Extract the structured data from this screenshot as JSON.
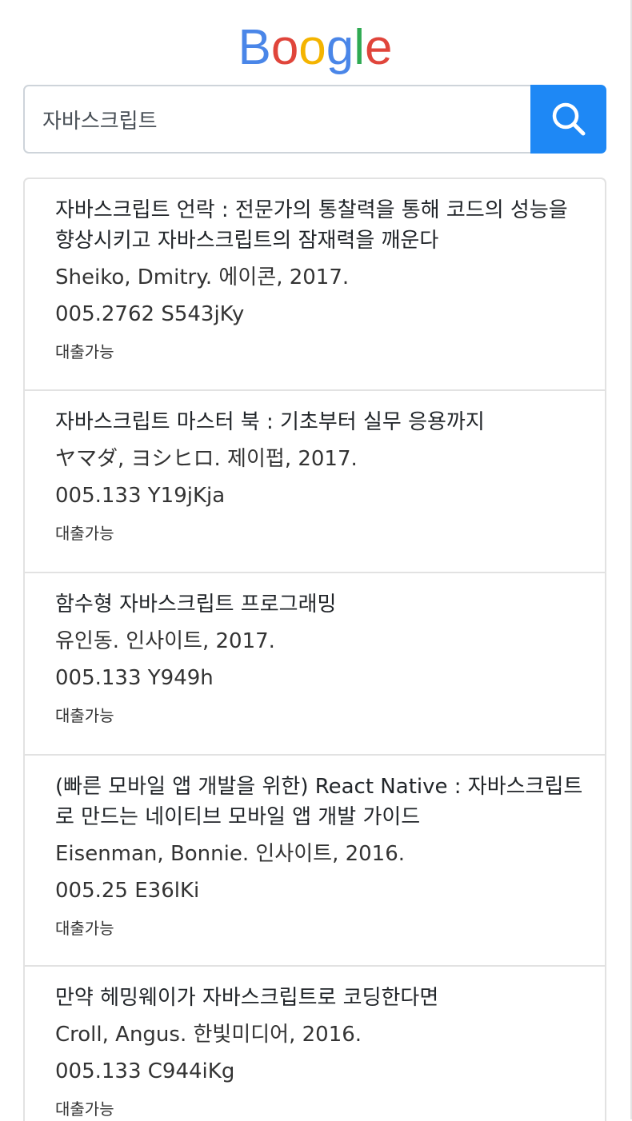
{
  "logo": {
    "letters": [
      {
        "char": "B",
        "color": "#4a86e8"
      },
      {
        "char": "o",
        "color": "#e0453b"
      },
      {
        "char": "o",
        "color": "#f4b400"
      },
      {
        "char": "g",
        "color": "#4a86e8"
      },
      {
        "char": "l",
        "color": "#2faa52"
      },
      {
        "char": "e",
        "color": "#e0453b"
      }
    ]
  },
  "search": {
    "value": "자바스크립트",
    "button_icon": "search-icon",
    "button_color": "#1e88f5"
  },
  "results": [
    {
      "title": "자바스크립트 언락 : 전문가의 통찰력을 통해 코드의 성능을 향상시키고 자바스크립트의 잠재력을 깨운다",
      "author": "Sheiko, Dmitry. 에이콘, 2017.",
      "call_number": "005.2762 S543jKy",
      "status": "대출가능"
    },
    {
      "title": "자바스크립트 마스터 북 : 기초부터 실무 응용까지",
      "author": "ヤマダ, ヨシヒロ. 제이펍, 2017.",
      "call_number": "005.133 Y19jKja",
      "status": "대출가능"
    },
    {
      "title": "함수형 자바스크립트 프로그래밍",
      "author": "유인동. 인사이트, 2017.",
      "call_number": "005.133 Y949h",
      "status": "대출가능"
    },
    {
      "title": "(빠른 모바일 앱 개발을 위한) React Native : 자바스크립트로 만드는 네이티브 모바일 앱 개발 가이드",
      "author": "Eisenman, Bonnie. 인사이트, 2016.",
      "call_number": "005.25 E36lKi",
      "status": "대출가능"
    },
    {
      "title": "만약 헤밍웨이가 자바스크립트로 코딩한다면",
      "author": "Croll, Angus. 한빛미디어, 2016.",
      "call_number": "005.133 C944iKg",
      "status": "대출가능"
    }
  ]
}
